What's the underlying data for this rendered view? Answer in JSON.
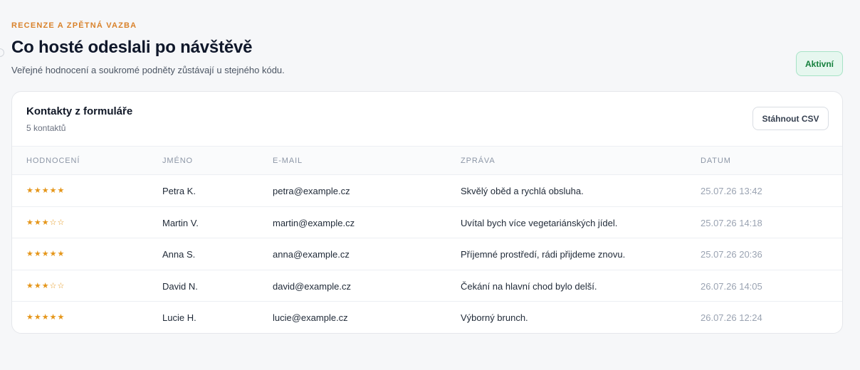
{
  "header": {
    "eyebrow": "RECENZE A ZPĚTNÁ VAZBA",
    "title": "Co hosté odeslali po návštěvě",
    "subtitle": "Veřejné hodnocení a soukromé podněty zůstávají u stejného kódu.",
    "status": "Aktivní"
  },
  "card": {
    "title": "Kontakty z formuláře",
    "count": "5 kontaktů",
    "download_label": "Stáhnout CSV"
  },
  "table": {
    "columns": [
      "HODNOCENÍ",
      "JMÉNO",
      "E-MAIL",
      "ZPRÁVA",
      "DATUM"
    ],
    "rows": [
      {
        "stars": "★★★★★",
        "rating": 5,
        "name": "Petra K.",
        "email": "petra@example.cz",
        "message": "Skvělý oběd a rychlá obsluha.",
        "date": "25.07.26 13:42"
      },
      {
        "stars": "★★★☆☆",
        "rating": 3,
        "name": "Martin V.",
        "email": "martin@example.cz",
        "message": "Uvítal bych více vegetariánských jídel.",
        "date": "25.07.26 14:18"
      },
      {
        "stars": "★★★★★",
        "rating": 5,
        "name": "Anna S.",
        "email": "anna@example.cz",
        "message": "Příjemné prostředí, rádi přijdeme znovu.",
        "date": "25.07.26 20:36"
      },
      {
        "stars": "★★★☆☆",
        "rating": 3,
        "name": "David N.",
        "email": "david@example.cz",
        "message": "Čekání na hlavní chod bylo delší.",
        "date": "26.07.26 14:05"
      },
      {
        "stars": "★★★★★",
        "rating": 5,
        "name": "Lucie H.",
        "email": "lucie@example.cz",
        "message": "Výborný brunch.",
        "date": "26.07.26 12:24"
      }
    ]
  },
  "colors": {
    "accent": "#d9822b",
    "star": "#e5961a",
    "status_bg": "#e6f7ef",
    "status_text": "#15803d"
  }
}
